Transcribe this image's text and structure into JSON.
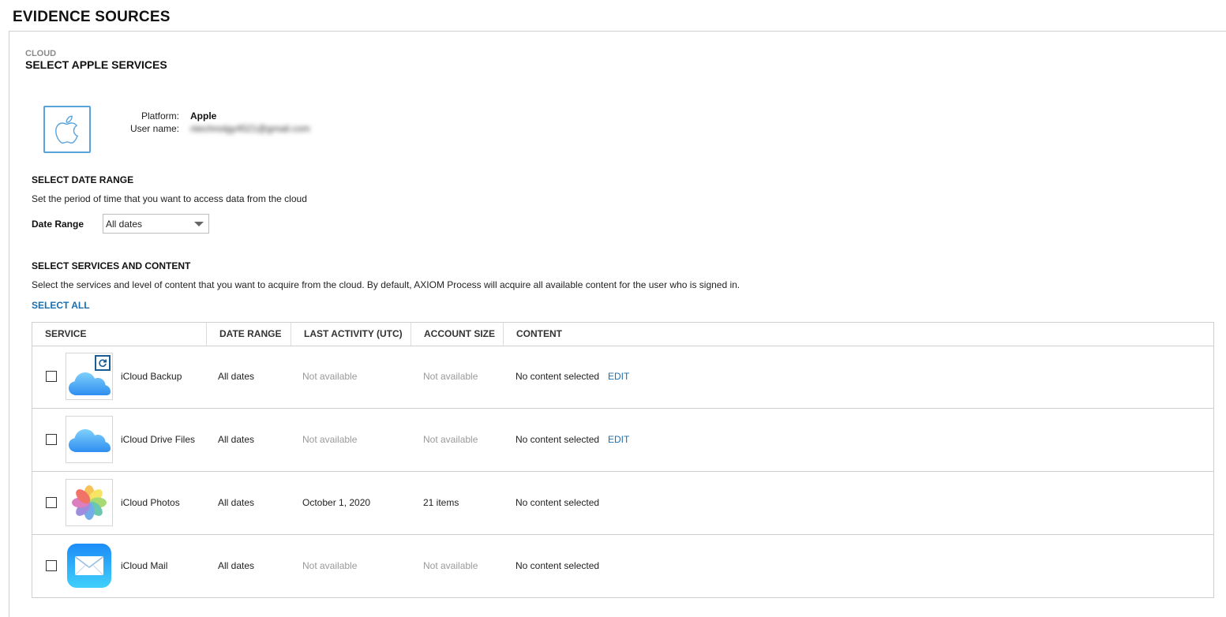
{
  "page": {
    "title": "EVIDENCE SOURCES"
  },
  "breadcrumb": "CLOUD",
  "heading": "SELECT APPLE SERVICES",
  "account": {
    "platform_label": "Platform:",
    "platform_value": "Apple",
    "username_label": "User name:",
    "username_value": "ntechnolgy4521@gmail.com",
    "logo_icon": "apple-logo-icon"
  },
  "date_range_section": {
    "heading": "SELECT DATE RANGE",
    "description": "Set the period of time that you want to access data from the cloud",
    "label": "Date Range",
    "selected": "All dates"
  },
  "services_section": {
    "heading": "SELECT SERVICES AND CONTENT",
    "description": "Select the services and level of content that you want to acquire from the cloud. By default, AXIOM Process will acquire all available content for the user who is signed in.",
    "select_all": "SELECT ALL",
    "columns": [
      "SERVICE",
      "DATE RANGE",
      "LAST ACTIVITY (UTC)",
      "ACCOUNT SIZE",
      "CONTENT"
    ],
    "rows": [
      {
        "name": "iCloud Backup",
        "icon": "icloud-backup-icon",
        "date_range": "All dates",
        "last_activity": "Not available",
        "account_size": "Not available",
        "content": "No content selected",
        "edit": "EDIT",
        "checked": false
      },
      {
        "name": "iCloud Drive Files",
        "icon": "icloud-drive-icon",
        "date_range": "All dates",
        "last_activity": "Not available",
        "account_size": "Not available",
        "content": "No content selected",
        "edit": "EDIT",
        "checked": false
      },
      {
        "name": "iCloud Photos",
        "icon": "photos-icon",
        "date_range": "All dates",
        "last_activity": "October 1, 2020",
        "account_size": "21 items",
        "content": "No content selected",
        "checked": false
      },
      {
        "name": "iCloud Mail",
        "icon": "mail-icon",
        "date_range": "All dates",
        "last_activity": "Not available",
        "account_size": "Not available",
        "content": "No content selected",
        "checked": false
      }
    ]
  },
  "colors": {
    "link": "#1a6fb0",
    "muted_text": "#9a9a9a",
    "logo_border": "#5aa3d9",
    "border": "#cfcfcf"
  }
}
